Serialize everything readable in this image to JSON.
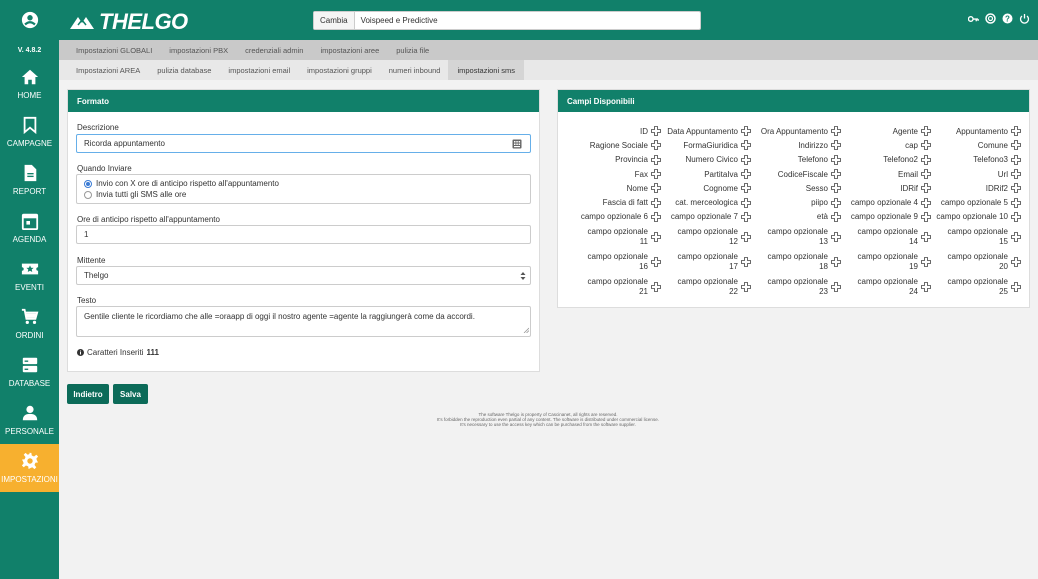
{
  "app": {
    "logo_text": "THELGO",
    "version": "V. 4.8.2"
  },
  "sidebar": {
    "items": [
      {
        "label": "HOME",
        "icon": "home-icon"
      },
      {
        "label": "CAMPAGNE",
        "icon": "bookmark-icon"
      },
      {
        "label": "REPORT",
        "icon": "document-icon"
      },
      {
        "label": "AGENDA",
        "icon": "calendar-icon"
      },
      {
        "label": "EVENTI",
        "icon": "ticket-icon"
      },
      {
        "label": "ORDINI",
        "icon": "cart-icon"
      },
      {
        "label": "DATABASE",
        "icon": "server-icon"
      },
      {
        "label": "PERSONALE",
        "icon": "person-icon"
      },
      {
        "label": "IMPOSTAZIONI",
        "icon": "gear-icon"
      }
    ],
    "active": "IMPOSTAZIONI"
  },
  "header": {
    "cambia_label": "Cambia",
    "selected_account": "Voispeed e Predictive"
  },
  "tabs_row1": [
    "Impostazioni GLOBALI",
    "impostazioni PBX",
    "credenziali admin",
    "impostazioni aree",
    "pulizia file"
  ],
  "tabs_row2": [
    "Impostazioni AREA",
    "pulizia database",
    "impostazioni email",
    "impostazioni gruppi",
    "numeri inbound",
    "impostazioni sms"
  ],
  "active_tab": "impostazioni sms",
  "form": {
    "title": "Formato",
    "descrizione_label": "Descrizione",
    "descrizione_value": "Ricorda appuntamento",
    "quando_label": "Quando Inviare",
    "option1": "Invio con X ore di anticipo rispetto all'appuntamento",
    "option2": "Invia tutti gli SMS alle ore",
    "ore_label": "Ore di anticipo rispetto all'appuntamento",
    "ore_value": "1",
    "mittente_label": "Mittente",
    "mittente_value": "Thelgo",
    "testo_label": "Testo",
    "testo_value": "Gentile cliente le ricordiamo che alle =oraapp di oggi il nostro agente =agente la raggiungerà come da accordi.",
    "caratteri_label": "Caratteri Inseriti",
    "caratteri_count": "111"
  },
  "buttons": {
    "back": "Indietro",
    "save": "Salva"
  },
  "fields_panel": {
    "title": "Campi Disponibili",
    "fields": [
      "ID",
      "Data Appuntamento",
      "Ora Appuntamento",
      "Agente",
      "Appuntamento",
      "Ragione Sociale",
      "FormaGiuridica",
      "Indirizzo",
      "cap",
      "Comune",
      "Provincia",
      "Numero Civico",
      "Telefono",
      "Telefono2",
      "Telefono3",
      "Fax",
      "PartitaIva",
      "CodiceFiscale",
      "Email",
      "Url",
      "Nome",
      "Cognome",
      "Sesso",
      "IDRif",
      "IDRif2",
      "Fascia di fatt",
      "cat. merceologica",
      "piipo",
      "campo opzionale 4",
      "campo opzionale 5",
      "campo opzionale 6",
      "campo opzionale 7",
      "età",
      "campo opzionale 9",
      "campo opzionale 10",
      "campo opzionale 11",
      "campo opzionale 12",
      "campo opzionale 13",
      "campo opzionale 14",
      "campo opzionale 15",
      "campo opzionale 16",
      "campo opzionale 17",
      "campo opzionale 18",
      "campo opzionale 19",
      "campo opzionale 20",
      "campo opzionale 21",
      "campo opzionale 22",
      "campo opzionale 23",
      "campo opzionale 24",
      "campo opzionale 25"
    ]
  },
  "footer": {
    "line1": "The software Thelgo is property of Cascinanet, all rights are reserved.",
    "line2": "It's forbidden the reproduction even partial of any content. The software is distributed under commercial license.",
    "line3": "It's necessary to use the access key which can be purchased from the software supplier."
  },
  "colors": {
    "brand": "#11806a",
    "active_sidebar": "#f7b02f"
  }
}
